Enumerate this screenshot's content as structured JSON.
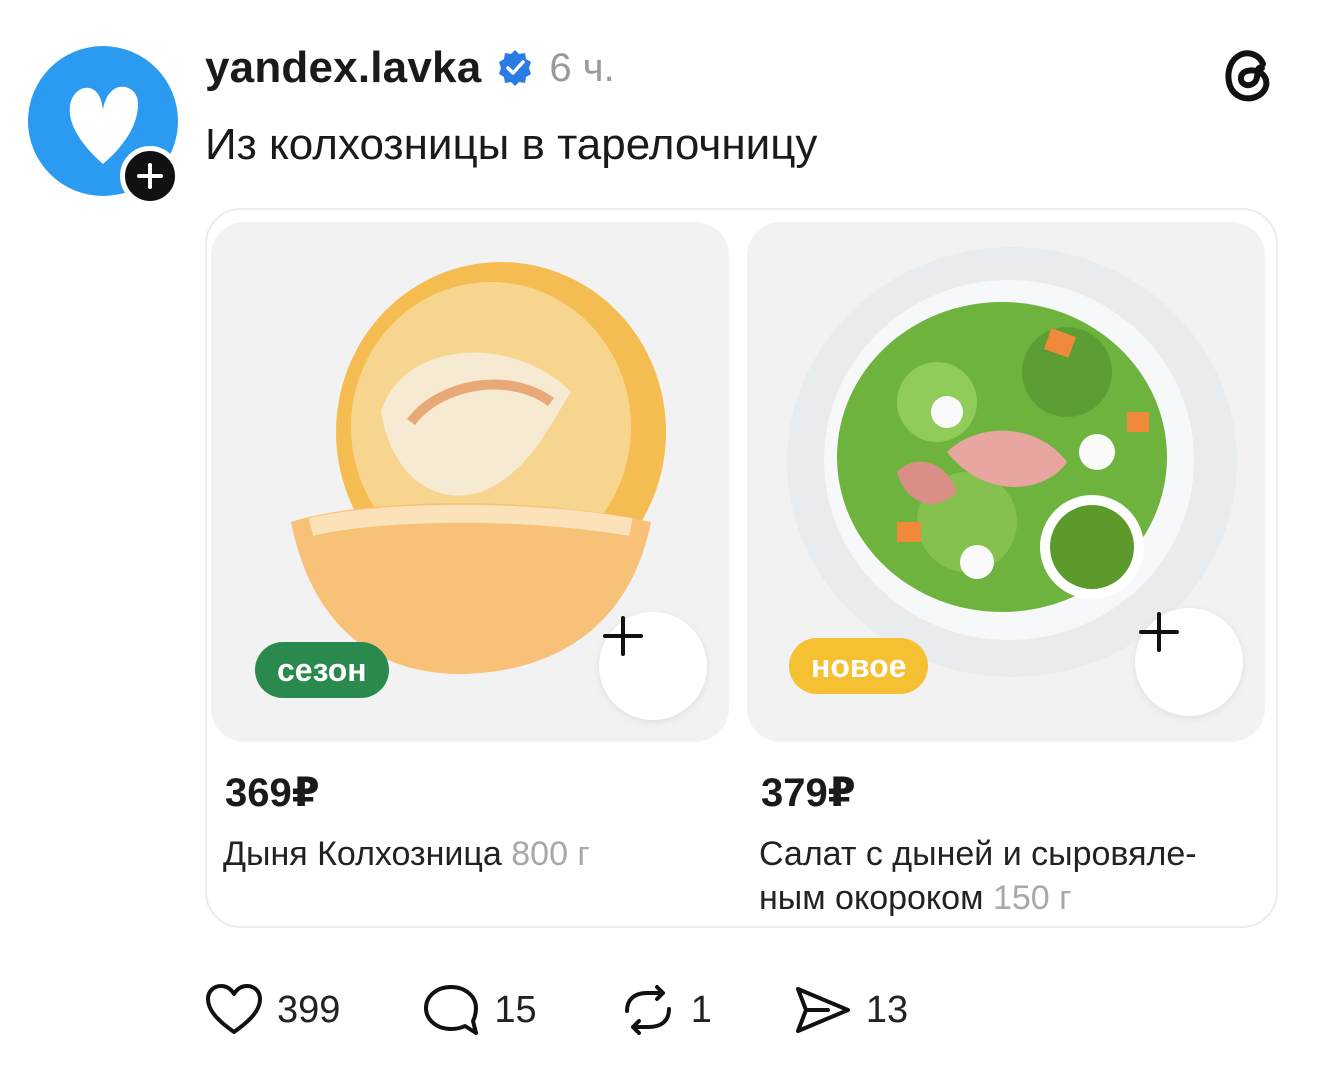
{
  "post": {
    "username": "yandex.lavka",
    "time": "6 ч.",
    "text": "Из колхозницы в тарелочницу"
  },
  "products": [
    {
      "badge": "сезон",
      "price": "369₽",
      "name": "Дыня Колхозница",
      "weight": "800 г",
      "badge_color": "#2a8a4e"
    },
    {
      "badge": "новое",
      "price": "379₽",
      "name": "Салат с дыней и сыровяле-ным окороком",
      "weight": "150 г",
      "badge_color": "#f5c133"
    }
  ],
  "actions": {
    "likes": "399",
    "comments": "15",
    "reposts": "1",
    "shares": "13"
  },
  "icons": [
    "heart-icon",
    "comment-icon",
    "repost-icon",
    "share-icon",
    "threads-logo-icon",
    "verified-icon",
    "plus-icon"
  ],
  "colors": {
    "avatar": "#2a9bf0",
    "verified": "#2a7be4",
    "muted": "#9a9a9a"
  }
}
